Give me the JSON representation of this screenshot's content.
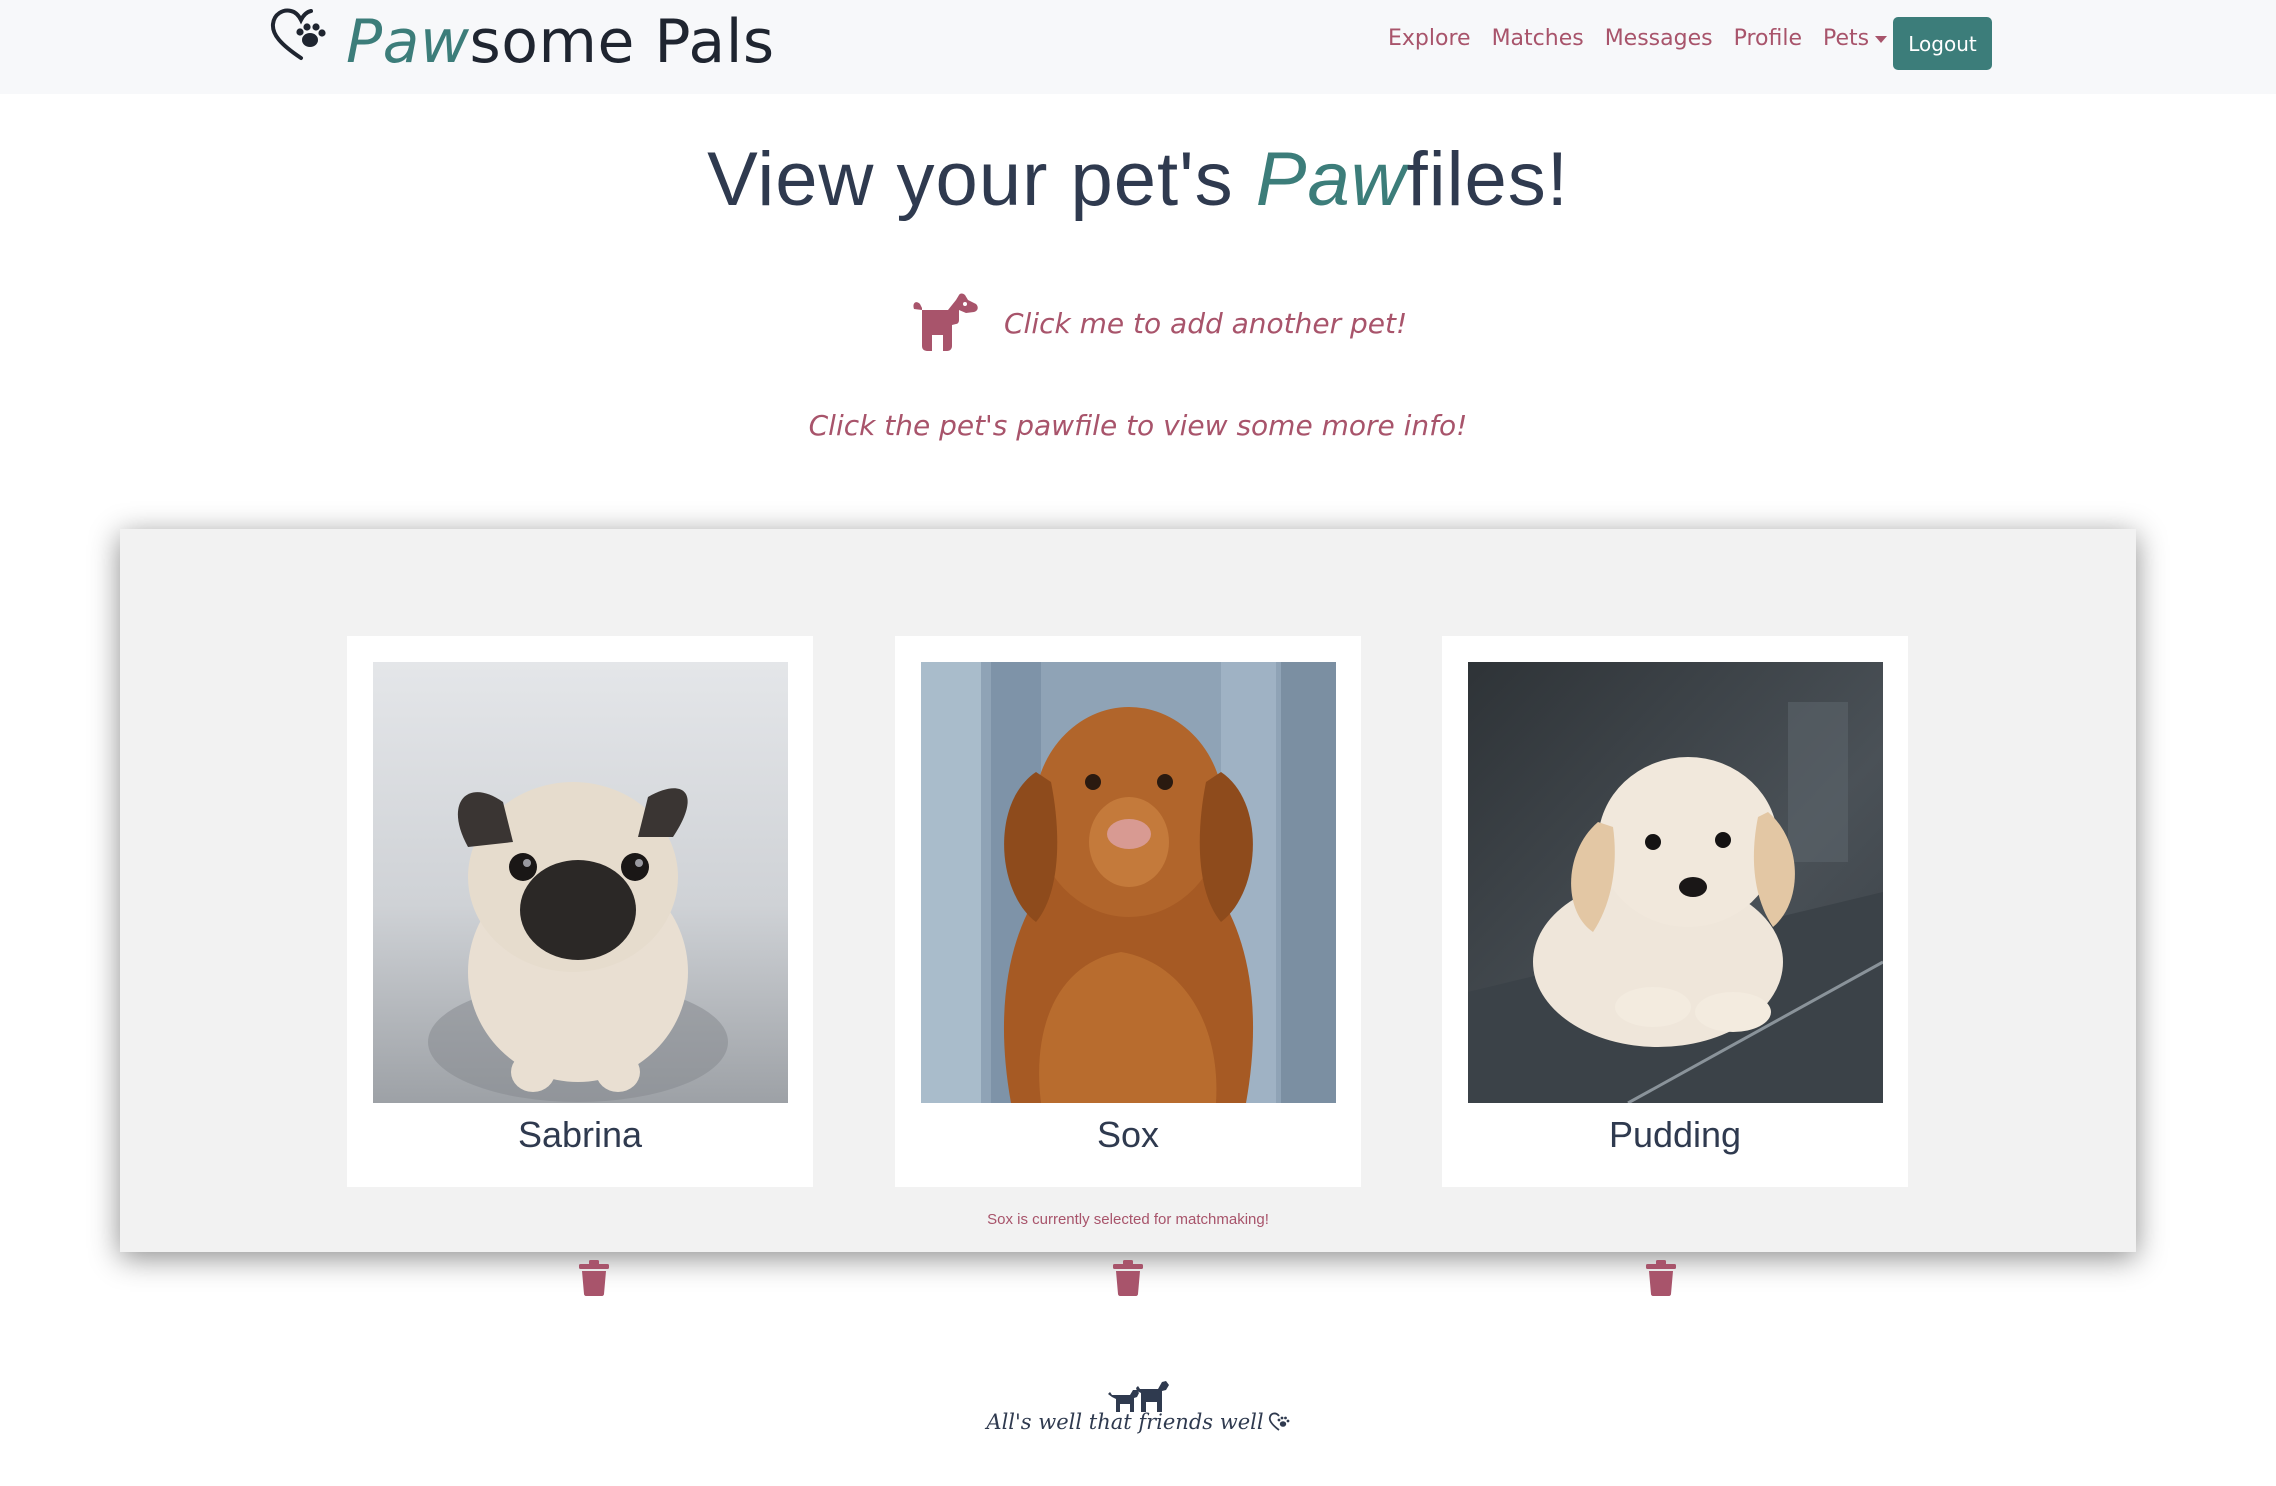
{
  "navbar": {
    "brand": {
      "prefix": "Paw",
      "suffix": "some Pals"
    },
    "links": [
      "Explore",
      "Matches",
      "Messages",
      "Profile"
    ],
    "pets_dropdown": "Pets",
    "logout": "Logout"
  },
  "page": {
    "title_prefix": "View your pet's ",
    "title_paw": "Paw",
    "title_suffix": "files!",
    "add_pet": "Click me to add another pet!",
    "instruction": "Click the pet's pawfile to view some more info!"
  },
  "pets": [
    {
      "name": "Sabrina",
      "icon": "pug-photo"
    },
    {
      "name": "Sox",
      "icon": "retriever-photo"
    },
    {
      "name": "Pudding",
      "icon": "puppy-photo"
    }
  ],
  "selection_note": "Sox is currently selected for matchmaking!",
  "footer": {
    "tagline": "All's well that friends well"
  },
  "colors": {
    "accent_teal": "#3c7d7a",
    "accent_rose": "#a8546b",
    "text_dark": "#2f3a4f",
    "panel_bg": "#f2f2f2",
    "navbar_bg": "#f7f8fa"
  }
}
